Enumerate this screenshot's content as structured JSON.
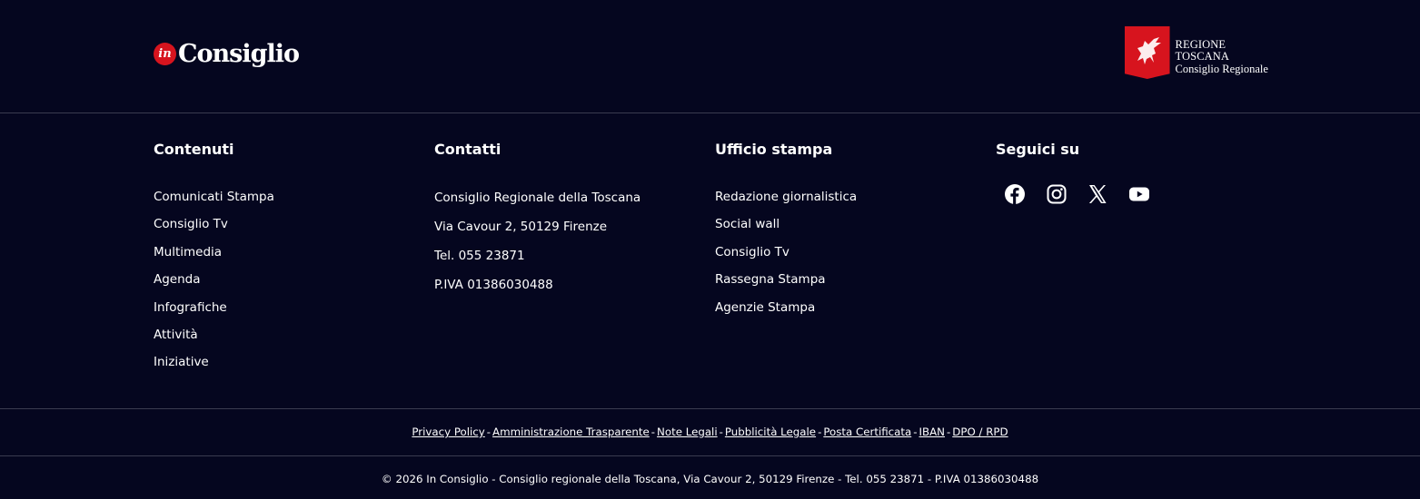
{
  "brand": {
    "badge": "in",
    "name": "Consiglio"
  },
  "region": {
    "line1": "REGIONE TOSCANA",
    "line2": "Consiglio Regionale"
  },
  "columns": {
    "contenuti": {
      "title": "Contenuti",
      "items": [
        "Comunicati Stampa",
        "Consiglio Tv",
        "Multimedia",
        "Agenda",
        "Infografiche",
        "Attività",
        "Iniziative"
      ]
    },
    "contatti": {
      "title": "Contatti",
      "items": [
        "Consiglio Regionale della Toscana",
        "Via Cavour 2, 50129 Firenze",
        "Tel. 055 23871",
        "P.IVA 01386030488"
      ]
    },
    "ufficio": {
      "title": "Ufficio stampa",
      "items": [
        "Redazione giornalistica",
        "Social wall",
        "Consiglio Tv",
        "Rassegna Stampa",
        "Agenzie Stampa"
      ]
    },
    "seguici": {
      "title": "Seguici su",
      "icons": [
        "facebook-icon",
        "instagram-icon",
        "x-icon",
        "youtube-icon"
      ]
    }
  },
  "legal": {
    "links": [
      "Privacy Policy",
      "Amministrazione Trasparente",
      "Note Legali",
      "Pubblicità Legale",
      "Posta Certificata",
      "IBAN",
      "DPO / RPD"
    ],
    "separator": "-"
  },
  "copyright": "© 2026 In Consiglio - Consiglio regionale della Toscana, Via Cavour 2, 50129 Firenze - Tel. 055 23871 - P.IVA 01386030488",
  "colors": {
    "background": "#05061f",
    "accent": "#d7141e",
    "divider": "#3a3b4f",
    "text": "#ffffff"
  }
}
